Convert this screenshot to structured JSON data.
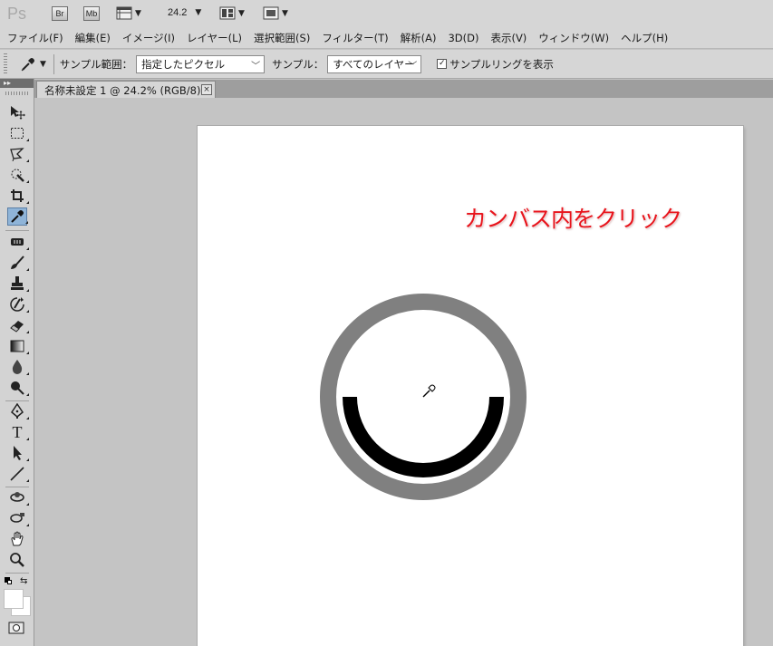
{
  "app": {
    "logo": "Ps",
    "bridge_button": "Br",
    "minibridge_button": "Mb",
    "zoom_value": "24.2"
  },
  "menu": {
    "items": [
      "ファイル(F)",
      "編集(E)",
      "イメージ(I)",
      "レイヤー(L)",
      "選択範囲(S)",
      "フィルター(T)",
      "解析(A)",
      "3D(D)",
      "表示(V)",
      "ウィンドウ(W)",
      "ヘルプ(H)"
    ]
  },
  "options": {
    "sample_size_label": "サンプル範囲：",
    "sample_size_value": "指定したピクセル",
    "sample_label": "サンプル：",
    "sample_value": "すべてのレイヤー",
    "show_ring_label": "サンプルリングを表示",
    "show_ring_checked": true
  },
  "document": {
    "tab_title": "名称未設定 1 @ 24.2% (RGB/8)",
    "close_glyph": "×"
  },
  "canvas": {
    "annotation": "カンバス内をクリック",
    "annotation_color": "#e8141c",
    "ring_outer_color": "#808080",
    "ring_inner_color": "#000000",
    "background_color": "#ffffff"
  },
  "toolbox": {
    "tools": [
      "move-tool-icon",
      "marquee-tool-icon",
      "lasso-tool-icon",
      "quick-selection-tool-icon",
      "crop-tool-icon",
      "eyedropper-tool-icon",
      "spot-healing-tool-icon",
      "brush-tool-icon",
      "clone-stamp-tool-icon",
      "history-brush-tool-icon",
      "eraser-tool-icon",
      "gradient-tool-icon",
      "blur-tool-icon",
      "dodge-tool-icon",
      "pen-tool-icon",
      "type-tool-icon",
      "path-selection-tool-icon",
      "line-tool-icon",
      "3d-rotate-tool-icon",
      "3d-orbit-tool-icon",
      "hand-tool-icon",
      "zoom-tool-icon"
    ],
    "active_tool": "eyedropper-tool-icon",
    "type_tool_glyph": "T"
  }
}
